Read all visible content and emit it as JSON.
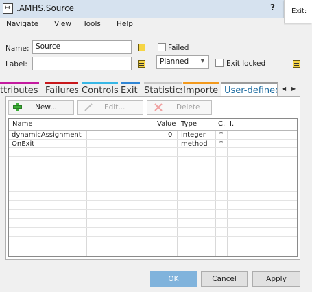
{
  "window": {
    "title": ".AMHS.Source",
    "help_label": "?",
    "title_icon": "↦"
  },
  "tooltip": {
    "text": "Exit:"
  },
  "menu": [
    "Navigate",
    "View",
    "Tools",
    "Help"
  ],
  "form": {
    "name_label": "Name:",
    "name_value": "Source",
    "failed_label": "Failed",
    "label_label": "Label:",
    "label_value": "",
    "status_value": "Planned",
    "exit_locked_label": "Exit locked"
  },
  "tabs": [
    {
      "label": "ttributes",
      "color": "#c41aa0"
    },
    {
      "label": "Failures",
      "color": "#c8171b"
    },
    {
      "label": "Controls",
      "color": "#38b7e6"
    },
    {
      "label": "Exit",
      "color": "#2f86d6"
    },
    {
      "label": "Statistics",
      "color": "#c8c8c8"
    },
    {
      "label": "Importer",
      "color": "#f39a1e"
    },
    {
      "label": "User-defined",
      "color": "#9c9c9c",
      "active": true
    }
  ],
  "toolbar": {
    "new_label": "New...",
    "edit_label": "Edit...",
    "delete_label": "Delete"
  },
  "table": {
    "columns": [
      "Name",
      "Value",
      "Type",
      "C.",
      "I."
    ],
    "rows": [
      {
        "name": "dynamicAssignment",
        "value": "0",
        "type": "integer",
        "c": "*",
        "i": ""
      },
      {
        "name": "OnExit",
        "value": "",
        "type": "method",
        "c": "*",
        "i": ""
      }
    ]
  },
  "footer": {
    "ok_label": "OK",
    "cancel_label": "Cancel",
    "apply_label": "Apply"
  }
}
